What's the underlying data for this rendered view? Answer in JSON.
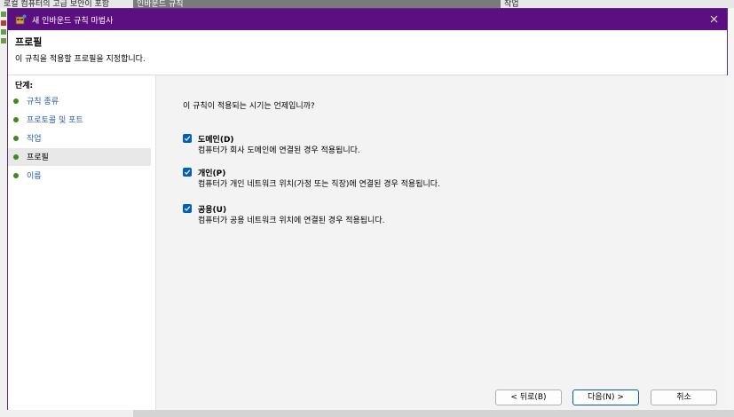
{
  "background_window": {
    "left_title": "로컬 컴퓨터의 고급 보안이 포함",
    "mid_title": "인바운드 규칙",
    "right_title": "작업"
  },
  "dialog": {
    "title": "새 인바운드 규칙 마법사",
    "header_title": "프로필",
    "header_subtitle": "이 규칙을 적용할 프로필을 지정합니다."
  },
  "steps": {
    "title": "단계:",
    "items": [
      {
        "label": "규칙 종류"
      },
      {
        "label": "프로토콜 및 포트"
      },
      {
        "label": "작업"
      },
      {
        "label": "프로필"
      },
      {
        "label": "이름"
      }
    ],
    "current_index": 3
  },
  "content": {
    "question": "이 규칙이 적용되는 시기는 언제입니까?",
    "options": [
      {
        "label": "도메인(D)",
        "description": "컴퓨터가 회사 도메인에 연결된 경우 적용됩니다.",
        "checked": true
      },
      {
        "label": "개인(P)",
        "description": "컴퓨터가 개인 네트워크 위치(가정 또는 직장)에 연결된 경우 적용됩니다.",
        "checked": true
      },
      {
        "label": "공용(U)",
        "description": "컴퓨터가 공용 네트워크 위치에 연결된 경우 적용됩니다.",
        "checked": true
      }
    ]
  },
  "buttons": {
    "back": "< 뒤로(B)",
    "next": "다음(N) >",
    "cancel": "취소"
  },
  "icons": {
    "app": "wizard-icon",
    "close": "close-icon",
    "checkbox": "checkmark-icon"
  },
  "colors": {
    "titlebar": "#5b0f80",
    "checkbox": "#005fb8",
    "step_dot": "#3d8a1f",
    "step_link": "#2a5ea8"
  }
}
